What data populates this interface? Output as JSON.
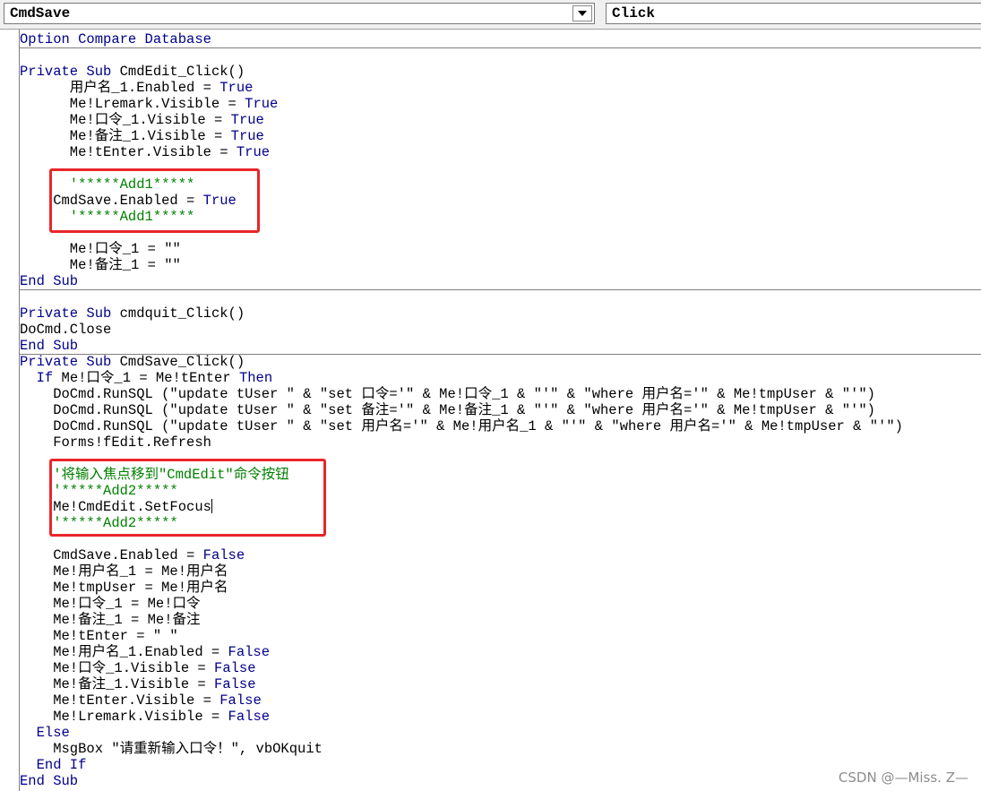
{
  "toolbar": {
    "object_combo": "CmdSave",
    "procedure_combo": "Click",
    "dropdown_icon": "triangle-down-icon"
  },
  "colors": {
    "keyword": "#00008b",
    "comment": "#008000",
    "text": "#000000",
    "highlight_box": "#e8262a"
  },
  "code": {
    "l01": "Option Compare Database",
    "l03_kw": "Private Sub ",
    "l03": "CmdEdit_Click()",
    "l04": "      用户名_1.Enabled = ",
    "l04_kw": "True",
    "l05": "      Me!Lremark.Visible = ",
    "l05_kw": "True",
    "l06": "      Me!口令_1.Visible = ",
    "l06_kw": "True",
    "l07": "      Me!备注_1.Visible = ",
    "l07_kw": "True",
    "l08": "      Me!tEnter.Visible = ",
    "l08_kw": "True",
    "l10": "      '*****Add1*****",
    "l11": "    CmdSave.Enabled = ",
    "l11_kw": "True",
    "l12": "      '*****Add1*****",
    "l14": "      Me!口令_1 = \"\"",
    "l15": "      Me!备注_1 = \"\"",
    "l16": "End Sub",
    "l18_kw": "Private Sub ",
    "l18": "cmdquit_Click()",
    "l19": "DoCmd.Close",
    "l20": "End Sub",
    "l21_kw": "Private Sub ",
    "l21": "CmdSave_Click()",
    "l22_kw1": "  If ",
    "l22": "Me!口令_1 = Me!tEnter ",
    "l22_kw2": "Then",
    "l23": "    DoCmd.RunSQL (\"update tUser \" & \"set 口令='\" & Me!口令_1 & \"'\" & \"where 用户名='\" & Me!tmpUser & \"'\")",
    "l24": "    DoCmd.RunSQL (\"update tUser \" & \"set 备注='\" & Me!备注_1 & \"'\" & \"where 用户名='\" & Me!tmpUser & \"'\")",
    "l25": "    DoCmd.RunSQL (\"update tUser \" & \"set 用户名='\" & Me!用户名_1 & \"'\" & \"where 用户名='\" & Me!tmpUser & \"'\")",
    "l26": "    Forms!fEdit.Refresh",
    "l28": "    '将输入焦点移到\"CmdEdit\"命令按钮",
    "l29": "    '*****Add2*****",
    "l30": "    Me!CmdEdit.SetFocus",
    "l31": "    '*****Add2*****",
    "l33": "    CmdSave.Enabled = ",
    "l33_kw": "False",
    "l34": "    Me!用户名_1 = Me!用户名",
    "l35": "    Me!tmpUser = Me!用户名",
    "l36": "    Me!口令_1 = Me!口令",
    "l37": "    Me!备注_1 = Me!备注",
    "l38": "    Me!tEnter = \" \"",
    "l39": "    Me!用户名_1.Enabled = ",
    "l39_kw": "False",
    "l40": "    Me!口令_1.Visible = ",
    "l40_kw": "False",
    "l41": "    Me!备注_1.Visible = ",
    "l41_kw": "False",
    "l42": "    Me!tEnter.Visible = ",
    "l42_kw": "False",
    "l43": "    Me!Lremark.Visible = ",
    "l43_kw": "False",
    "l44": "  Else",
    "l45": "    MsgBox \"请重新输入口令！\", vbOKquit",
    "l46": "  End If",
    "l47": "End Sub"
  },
  "watermark": "CSDN @—Miss. Z—"
}
